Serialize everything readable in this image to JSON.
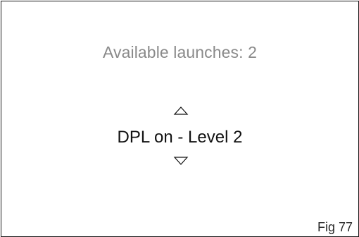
{
  "screen": {
    "available_launches": "Available launches: 2",
    "selected_option": "DPL on - Level 2",
    "figure_label": "Fig 77"
  },
  "icons": {
    "up": "triangle-up-outline-icon",
    "down": "triangle-down-outline-icon"
  },
  "colors": {
    "background": "#ffffff",
    "border": "#1a1a1a",
    "secondary_text": "#8a8a8a",
    "primary_text": "#111111"
  }
}
